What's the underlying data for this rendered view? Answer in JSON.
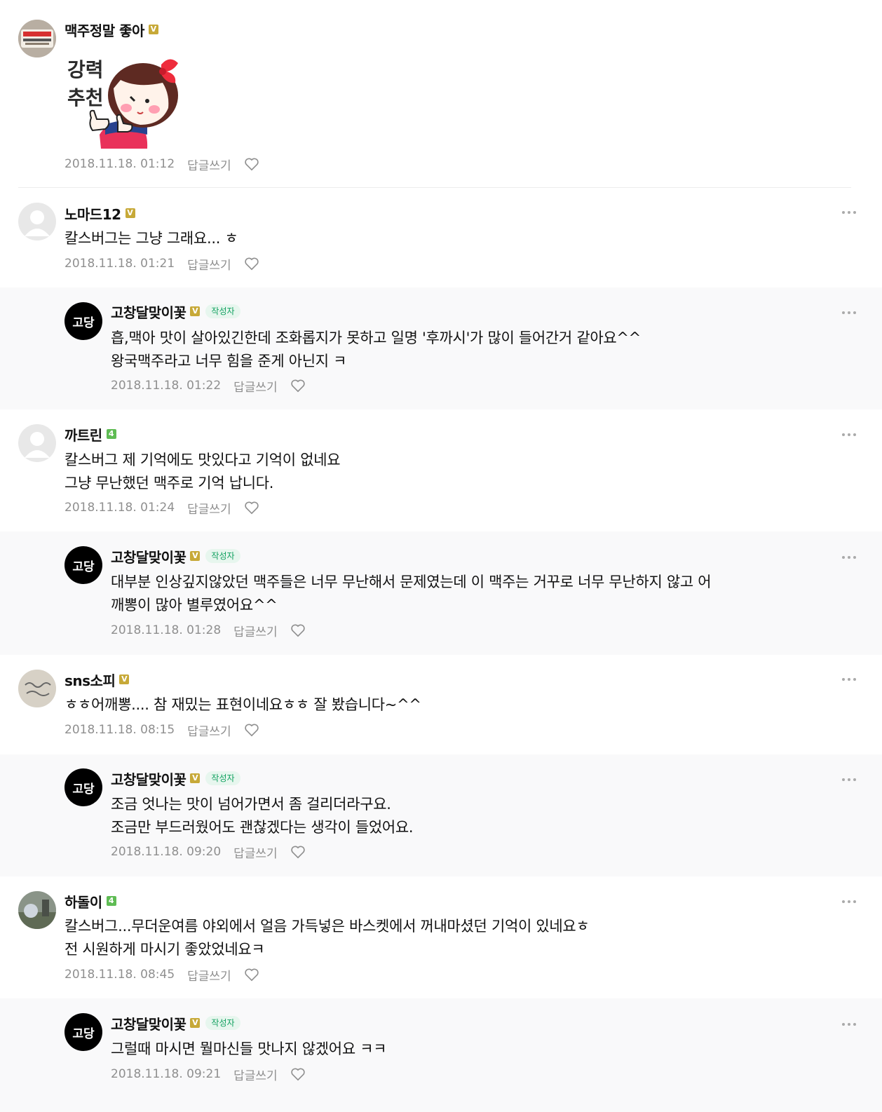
{
  "comments": [
    {
      "nick": "맥주정말 좋아",
      "badge": "V",
      "sticker": [
        "강력",
        "추천"
      ],
      "date": "2018.11.18. 01:12",
      "reply_label": "답글쓰기"
    },
    {
      "nick": "노마드12",
      "badge": "V",
      "lines": [
        "칼스버그는 그냥 그래요... ㅎ"
      ],
      "date": "2018.11.18. 01:21",
      "reply_label": "답글쓰기"
    },
    {
      "nick": "고창달맞이꽃",
      "badge": "V",
      "author_label": "작성자",
      "avatar_text": "고당",
      "lines": [
        "흡,맥아 맛이 살아있긴한데 조화롭지가 못하고 일명 '후까시'가 많이 들어간거 같아요^^",
        "왕국맥주라고 너무 힘을 준게 아닌지 ㅋ"
      ],
      "date": "2018.11.18. 01:22",
      "reply_label": "답글쓰기"
    },
    {
      "nick": "까트린",
      "badge": "4",
      "lines": [
        "칼스버그 제 기억에도 맛있다고 기억이 없네요",
        "그냥 무난했던 맥주로 기억 납니다."
      ],
      "date": "2018.11.18. 01:24",
      "reply_label": "답글쓰기"
    },
    {
      "nick": "고창달맞이꽃",
      "badge": "V",
      "author_label": "작성자",
      "avatar_text": "고당",
      "lines": [
        "대부분 인상깊지않았던 맥주들은 너무 무난해서 문제였는데 이 맥주는 거꾸로 너무 무난하지 않고 어",
        "깨뽕이 많아 별루였어요^^"
      ],
      "date": "2018.11.18. 01:28",
      "reply_label": "답글쓰기"
    },
    {
      "nick": "sns소피",
      "badge": "V",
      "lines": [
        "ㅎㅎ어깨뽕.... 참 재밌는 표현이네요ㅎㅎ 잘 봤습니다~^^"
      ],
      "date": "2018.11.18. 08:15",
      "reply_label": "답글쓰기"
    },
    {
      "nick": "고창달맞이꽃",
      "badge": "V",
      "author_label": "작성자",
      "avatar_text": "고당",
      "lines": [
        "조금 엇나는 맛이 넘어가면서 좀 걸리더라구요.",
        "조금만 부드러웠어도 괜찮겠다는 생각이 들었어요."
      ],
      "date": "2018.11.18. 09:20",
      "reply_label": "답글쓰기"
    },
    {
      "nick": "하돌이",
      "badge": "4",
      "lines": [
        "칼스버그...무더운여름 야외에서 얼음 가득넣은 바스켓에서 꺼내마셨던 기억이 있네요ㅎ",
        "전 시원하게 마시기 좋았었네요ㅋ"
      ],
      "date": "2018.11.18. 08:45",
      "reply_label": "답글쓰기"
    },
    {
      "nick": "고창달맞이꽃",
      "badge": "V",
      "author_label": "작성자",
      "avatar_text": "고당",
      "lines": [
        "그럴때 마시면 뭘마신들 맛나지 않겠어요 ㅋㅋ"
      ],
      "date": "2018.11.18. 09:21",
      "reply_label": "답글쓰기"
    }
  ],
  "icons": {
    "heart": "heart-icon",
    "more": "more-icon",
    "profile": "default-profile-icon"
  },
  "colors": {
    "nick": "#111111",
    "meta": "#8f8f8f",
    "reply_bg": "#f9f9fa",
    "author_tag": "#10a05f",
    "badge_gold": "#c7a938",
    "badge_green": "#5fbc54"
  }
}
